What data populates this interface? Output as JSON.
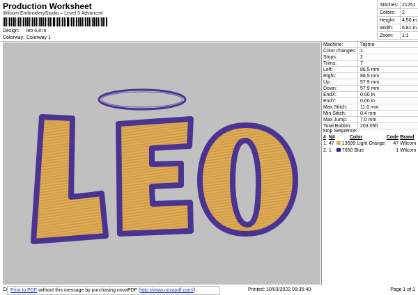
{
  "header": {
    "title": "Production Worksheet",
    "subtitle": "Wilcom EmbroideryStudio – Level 3 Advanced",
    "design_label": "Design:",
    "design_value": "leo 6,8 in",
    "colorway_label": "Colorway:",
    "colorway_value": "Colorway 1"
  },
  "stats": [
    {
      "label": "Stitches:",
      "value": "21251"
    },
    {
      "label": "Colors:",
      "value": "2"
    },
    {
      "label": "Height:",
      "value": "4.56 in"
    },
    {
      "label": "Width:",
      "value": "6.81 in"
    },
    {
      "label": "Zoom:",
      "value": "1:1"
    }
  ],
  "machine_info": [
    {
      "label": "Machine:",
      "value": "Tajima"
    },
    {
      "label": "Color changes:",
      "value": "1"
    },
    {
      "label": "Stops:",
      "value": "2"
    },
    {
      "label": "Trims:",
      "value": "7"
    },
    {
      "label": "Left:",
      "value": "86.5 mm"
    },
    {
      "label": "Right:",
      "value": "86.5 mm"
    },
    {
      "label": "Up:",
      "value": "57.9 mm"
    },
    {
      "label": "Down:",
      "value": "57.9 mm"
    },
    {
      "label": "EndX:",
      "value": "0.00 in"
    },
    {
      "label": "EndY:",
      "value": "0.00 in"
    },
    {
      "label": "Max Stitch:",
      "value": "11.0 mm"
    },
    {
      "label": "Min Stitch:",
      "value": "0.4 mm"
    },
    {
      "label": "Max Jump:",
      "value": "7.0 mm"
    },
    {
      "label": "Total Bobbin:",
      "value": "203.05ft"
    }
  ],
  "stop_sequence": {
    "title": "Stop Sequence:",
    "columns": {
      "hash": "#",
      "n": "N#",
      "color": "Color",
      "code": "Code",
      "brand": "Brand"
    },
    "rows": [
      {
        "hash": "1.",
        "n": "47",
        "swatch": "#e8a84c",
        "number": "13599",
        "color": "Light Orange",
        "code": "47",
        "brand": "Wilcom"
      },
      {
        "hash": "2.",
        "n": "1",
        "swatch": "#2b1f8a",
        "number": "7650",
        "color": "Blue",
        "code": "1",
        "brand": "Wilcom"
      }
    ]
  },
  "design_colors": {
    "fill": "#d9a650",
    "outline": "#4b3391",
    "canvas": "#c0c0c0"
  },
  "footer": {
    "cr": "Cr",
    "print_link": "Print to PDF",
    "banner_text": " without this message by purchasing novaPDF (",
    "url": "http://www.novapdf.com/",
    "banner_end": ")",
    "printed": "Printed: 10/03/2022 09:35:40",
    "page": "Page 1 of 1"
  }
}
